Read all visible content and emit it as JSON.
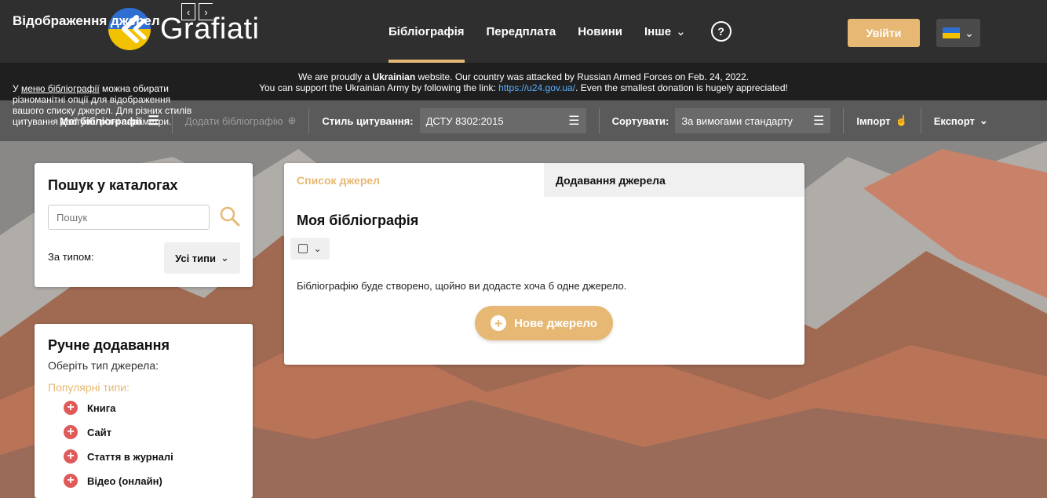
{
  "header": {
    "logo_text": "Grafiati",
    "nav": [
      {
        "label": "Бібліографія",
        "active": true
      },
      {
        "label": "Передплата",
        "active": false
      },
      {
        "label": "Новини",
        "active": false
      },
      {
        "label": "Інше",
        "active": false
      }
    ],
    "help_symbol": "?",
    "login_label": "Увійти"
  },
  "banner": {
    "line1_pre": "We are proudly a ",
    "line1_bold": "Ukrainian",
    "line1_post": " website. Our country was attacked by Russian Armed Forces on Feb. 24, 2022.",
    "line2_pre": "You can support the Ukrainian Army by following the link: ",
    "line2_link": "https://u24.gov.ua/",
    "line2_post": ". Even the smallest donation is hugely appreciated!"
  },
  "toolbar": {
    "my_bibliographies": "Мої бібліографії",
    "add_bibliography": "Додати бібліографію",
    "citation_style_label": "Стиль цитування:",
    "citation_style_value": "ДСТУ 8302:2015",
    "sort_label": "Сортувати:",
    "sort_value": "За вимогами стандарту",
    "import": "Імпорт",
    "export": "Експорт"
  },
  "search_card": {
    "title": "Пошук у каталогах",
    "placeholder": "Пошук",
    "type_label": "За типом:",
    "type_value": "Усі типи"
  },
  "manual_card": {
    "title": "Ручне додавання",
    "subtitle": "Оберіть тип джерела:",
    "popular": "Популярні типи:",
    "items": [
      "Книга",
      "Сайт",
      "Стаття в журналі",
      "Відео (онлайн)"
    ]
  },
  "main_card": {
    "tab_list": "Список джерел",
    "tab_add": "Додавання джерела",
    "title": "Моя бібліографія",
    "empty_text": "Бібліографію буде створено, щойно ви додасте хоча б одне джерело.",
    "new_source": "Нове джерело"
  },
  "tips_card": {
    "title": "Відображення джерел",
    "text_pre": "У ",
    "text_link": "меню бібліографії",
    "text_post": " можна обирати різноманітні опції для відображення вашого списку джерел. Для різних стилів цитування доступні різні параметри."
  },
  "colors": {
    "accent": "#e6b873",
    "teal": "#16998f",
    "header": "#2f2f2f",
    "plus_red": "#e05a5a"
  }
}
